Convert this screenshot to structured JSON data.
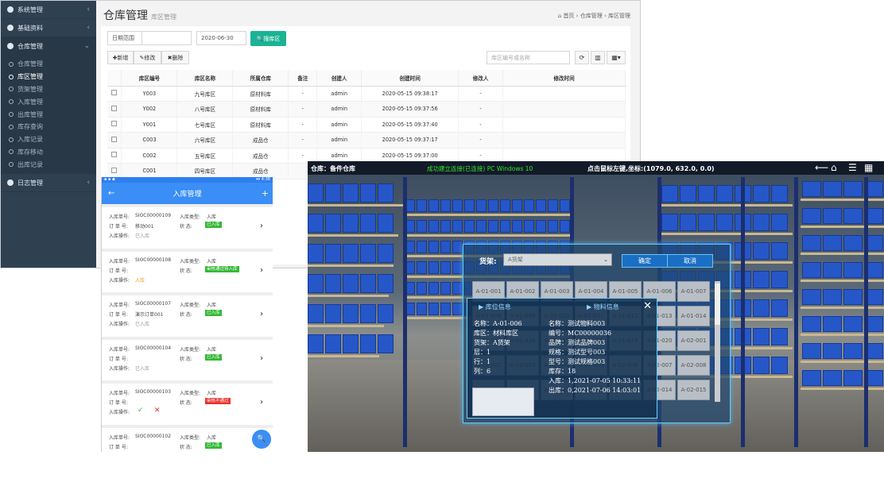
{
  "desktop": {
    "sidebar": {
      "groups": [
        {
          "label": "系统管理",
          "chevron": "‹"
        },
        {
          "label": "基础资料",
          "chevron": "‹"
        },
        {
          "label": "仓库管理",
          "chevron": "⌄"
        }
      ],
      "items": [
        "仓库管理",
        "库区管理",
        "货架管理",
        "入库管理",
        "出库管理",
        "库存查询",
        "入库记录",
        "库存移动",
        "出库记录"
      ],
      "log_group": {
        "label": "日志管理",
        "chevron": "‹"
      }
    },
    "page": {
      "title": "仓库管理",
      "subtitle": "库区管理"
    },
    "breadcrumb": {
      "home": "首页",
      "sep1": "›",
      "level1": "仓库管理",
      "sep2": "›",
      "level2": "库区管理"
    },
    "filter": {
      "date_label": "日期范围",
      "date_value": "2020-06-30",
      "search_label": "搜库区"
    },
    "toolbar": {
      "add": "✚新增",
      "edit": "✎修改",
      "delete": "✖删除",
      "search_placeholder": "库区编号或名称"
    },
    "table": {
      "headers": [
        "库区编号",
        "库区名称",
        "所属仓库",
        "备注",
        "创建人",
        "创建时间",
        "修改人",
        "修改时间"
      ],
      "rows": [
        [
          "Y003",
          "九号库区",
          "原材料库",
          "-",
          "admin",
          "2020-05-15 09:38:17",
          "-",
          ""
        ],
        [
          "Y002",
          "八号库区",
          "原材料库",
          "-",
          "admin",
          "2020-05-15 09:37:56",
          "-",
          ""
        ],
        [
          "Y001",
          "七号库区",
          "原材料库",
          "-",
          "admin",
          "2020-05-15 09:37:40",
          "-",
          ""
        ],
        [
          "C003",
          "六号库区",
          "成品仓",
          "-",
          "admin",
          "2020-05-15 09:37:17",
          "-",
          ""
        ],
        [
          "C002",
          "五号库区",
          "成品仓",
          "-",
          "admin",
          "2020-05-15 09:37:00",
          "-",
          ""
        ],
        [
          "C001",
          "四号库区",
          "成品仓",
          "",
          "",
          "",
          "",
          ""
        ]
      ]
    }
  },
  "mobile": {
    "status_left": "▪ ▪ ◆",
    "status_right": "▾▾ 4:38",
    "title": "入库管理",
    "back": "←",
    "add": "+",
    "labels": {
      "order_no": "入库单号:",
      "sub_no": "订 单 号:",
      "op": "入库操作:",
      "type": "入库类型:",
      "state": "状      态:"
    },
    "cards": [
      {
        "order": "SIOC00000109",
        "sub": "移动001",
        "op": "已入库",
        "type": "入库",
        "state": "已入库",
        "state_color": "#35b935"
      },
      {
        "order": "SIOC00000108",
        "sub": "",
        "op": "入库",
        "type": "入库",
        "state": "审核通过待入库",
        "state_color": "#35b935"
      },
      {
        "order": "SIOC00000107",
        "sub": "演示订单001",
        "op": "已入库",
        "type": "入库",
        "state": "已入库",
        "state_color": "#35b935"
      },
      {
        "order": "SIOC00000104",
        "sub": "",
        "op": "已入库",
        "type": "入库",
        "state": "已入库",
        "state_color": "#35b935"
      },
      {
        "order": "SIOC00000103",
        "sub": "",
        "op": "",
        "type": "入库",
        "state": "审核不通过",
        "state_color": "#e8352f"
      },
      {
        "order": "SIOC00000102",
        "sub": "",
        "op": "",
        "type": "入库",
        "state": "已入库",
        "state_color": "#35b935"
      }
    ],
    "icons": {
      "approve": "✓",
      "reject": "✕",
      "pending": "◷",
      "search": "🔍"
    }
  },
  "warehouse3d": {
    "title": "仓库：备件仓库",
    "status": "点击鼠标左键,坐标:(1079.0, 632.0, 0.0)",
    "overlay_text": "成功建立连接(已连接) PC Windows 10",
    "rack_label": "货架:",
    "rack_select": "A货架",
    "confirm": "确定",
    "cancel": "取消",
    "cells": [
      "A-01-001",
      "A-01-002",
      "A-01-003",
      "A-01-004",
      "A-01-005",
      "A-01-006",
      "A-01-007",
      "A-01-008",
      "A-01-009",
      "A-01-010",
      "A-01-011",
      "A-01-012",
      "A-01-013",
      "A-01-014",
      "A-01-015",
      "A-01-016",
      "A-01-017",
      "A-01-018",
      "A-01-019",
      "A-01-020",
      "A-02-001",
      "A-02-002",
      "A-02-003",
      "A-02-004",
      "A-02-005",
      "A-02-006",
      "A-02-007",
      "A-02-008",
      "A-02-009",
      "A-02-010",
      "A-02-011",
      "A-02-012",
      "A-02-013",
      "A-02-014",
      "A-02-015"
    ],
    "info": {
      "left_title": "库位信息",
      "right_title": "物料信息",
      "left_lines": [
        "名称：A-01-006",
        "库区：材料库区",
        "货架：A货架",
        "层：1",
        "行：1",
        "列：6"
      ],
      "right_lines": [
        "名称：测试物料003",
        "编号：MC00000036",
        "品牌：测试品牌003",
        "规格：测试型号003",
        "型号：测试规格003",
        "库存：18",
        "入库：1,2021-07-05 10:33:11",
        "出库：0,2021-07-06 14:03:01"
      ]
    }
  },
  "colors": {
    "sidebar": "#2f4050",
    "primary": "#1ab394",
    "mobile_bar": "#3a8ef6"
  }
}
